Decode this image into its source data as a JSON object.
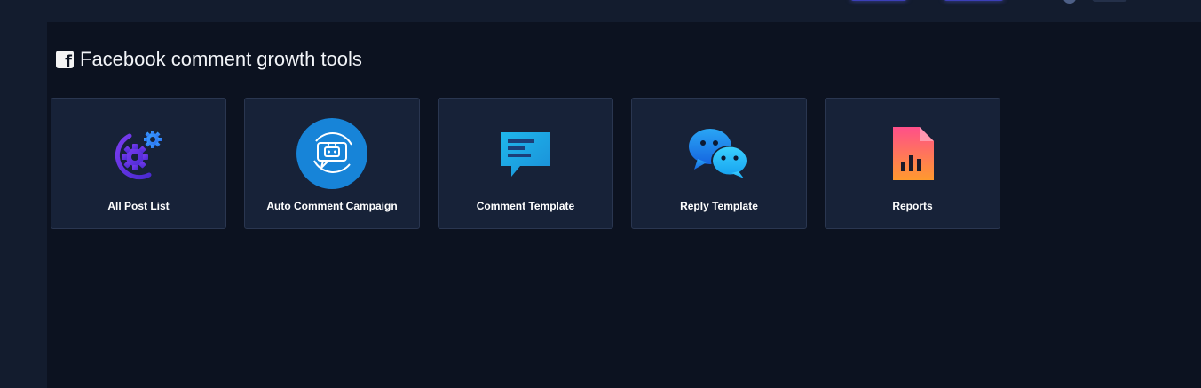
{
  "page": {
    "section_title": "Facebook comment growth tools",
    "section_icon": "facebook-square-icon"
  },
  "tools": [
    {
      "label": "All Post List",
      "icon": "gears-icon"
    },
    {
      "label": "Auto Comment Campaign",
      "icon": "chatbot-icon"
    },
    {
      "label": "Comment Template",
      "icon": "comment-lines-icon"
    },
    {
      "label": "Reply Template",
      "icon": "chat-bubbles-icon"
    },
    {
      "label": "Reports",
      "icon": "report-document-icon"
    }
  ],
  "colors": {
    "page_bg": "#0c1220",
    "card_bg": "#172238",
    "card_border": "#2a3650",
    "accent": "#3b3fb8"
  }
}
